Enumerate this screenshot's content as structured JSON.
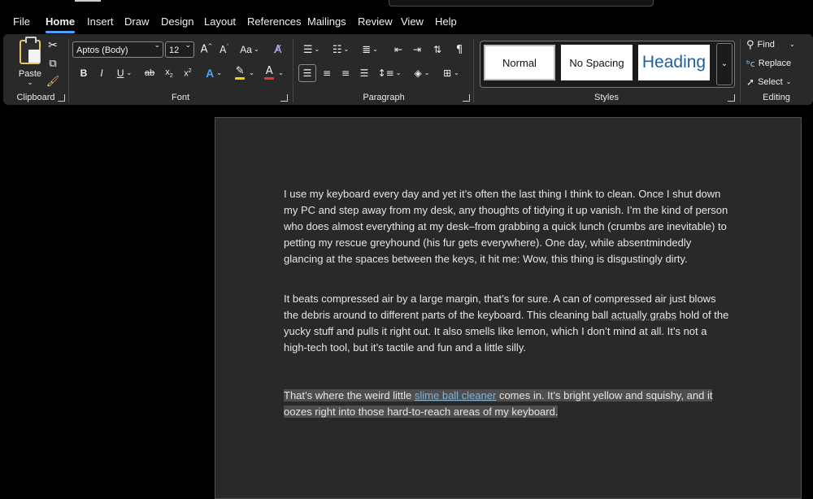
{
  "ribbon_tabs": [
    "File",
    "Home",
    "Insert",
    "Draw",
    "Design",
    "Layout",
    "References",
    "Mailings",
    "Review",
    "View",
    "Help"
  ],
  "active_tab": "Home",
  "clipboard": {
    "paste_label": "Paste",
    "group_label": "Clipboard"
  },
  "font": {
    "font_name": "Aptos (Body)",
    "font_size": "12",
    "group_label": "Font",
    "change_case_label": "Aa",
    "highlight_color": "#f2d600",
    "font_color": "#e03c31"
  },
  "paragraph": {
    "group_label": "Paragraph"
  },
  "styles": {
    "group_label": "Styles",
    "items": [
      {
        "label": "Normal",
        "selected": true
      },
      {
        "label": "No Spacing",
        "selected": false
      },
      {
        "label": "Heading",
        "selected": false
      }
    ],
    "heading_color": "#1f5f9a"
  },
  "editing": {
    "group_label": "Editing",
    "find_label": "Find",
    "replace_label": "Replace",
    "select_label": "Select"
  },
  "document": {
    "paragraph1": "I use my keyboard every day and yet it’s often the last thing I think to clean. Once I shut down my PC and step away from my desk, any thoughts of tidying it up vanish. I’m the kind of person who does almost everything at my desk–from grabbing a quick lunch (crumbs are inevitable) to petting my rescue greyhound (his fur gets everywhere). One day, while absentmindedly glancing at the spaces between the keys, it hit me: Wow, this thing is disgustingly dirty.",
    "paragraph2_before": " It beats compressed air by a large margin, that’s for sure. A can of compressed air just blows the debris around to different parts of the keyboard. This cleaning ball ",
    "paragraph2_flagged": "actually grabs",
    "paragraph2_after": " hold of the yucky stuff and pulls it right out. It also smells like lemon, which I don’t mind at all. It’s not a high-tech tool, but it’s tactile and fun and a little silly.",
    "selected_before": "That’s where the weird little ",
    "selected_link": "slime ball cleaner",
    "selected_after": " comes in. It’s bright yellow and squishy, and it oozes right into those hard-to-reach areas of my keyboard."
  }
}
